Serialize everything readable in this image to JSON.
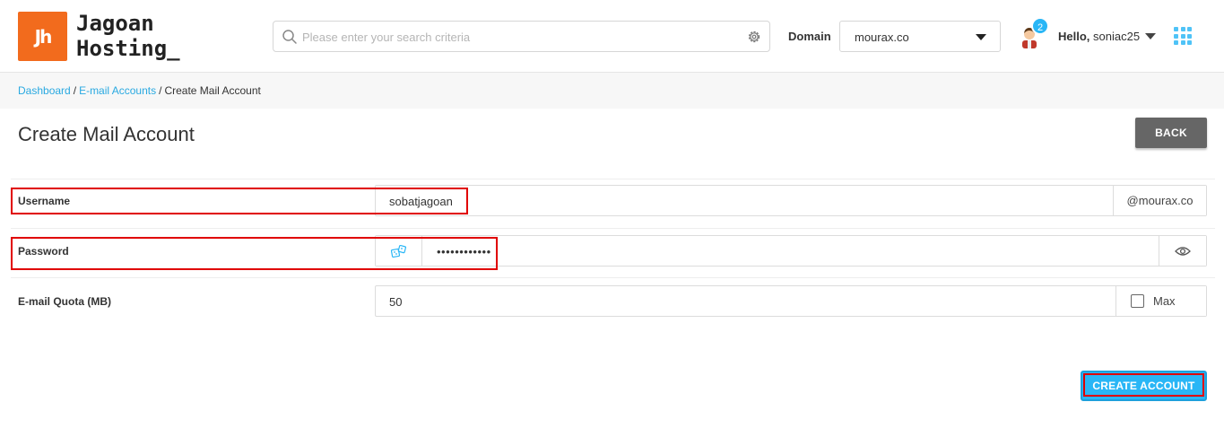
{
  "header": {
    "logo_text": "Jh",
    "brand_line1": "Jagoan",
    "brand_line2": "Hosting_",
    "search": {
      "placeholder": "Please enter your search criteria"
    },
    "domain": {
      "label": "Domain",
      "selected": "mourax.co"
    },
    "notifications": {
      "count": "2"
    },
    "user": {
      "greeting": "Hello,",
      "name": "soniac25"
    }
  },
  "breadcrumb": {
    "items": [
      "Dashboard",
      "E-mail Accounts",
      "Create Mail Account"
    ],
    "separator": "/"
  },
  "page": {
    "title": "Create Mail Account",
    "back_label": "BACK"
  },
  "form": {
    "username": {
      "label": "Username",
      "value": "sobatjagoan",
      "suffix": "@mourax.co"
    },
    "password": {
      "label": "Password",
      "value": "••••••••••••"
    },
    "quota": {
      "label": "E-mail Quota (MB)",
      "value": "50",
      "max_label": "Max",
      "max_checked": false
    },
    "submit_label": "CREATE ACCOUNT"
  },
  "colors": {
    "brand_orange": "#f26b1d",
    "accent_blue": "#29b6f6",
    "link_blue": "#29a9e1",
    "highlight_red": "#e00000",
    "back_gray": "#666666"
  },
  "icons": {
    "search": "search-icon",
    "settings": "gear-icon",
    "domain_dropdown": "chevron-down-icon",
    "avatar": "user-avatar-icon",
    "apps": "grid-apps-icon",
    "password_generate": "generate-password-icon",
    "password_visibility": "eye-icon"
  }
}
